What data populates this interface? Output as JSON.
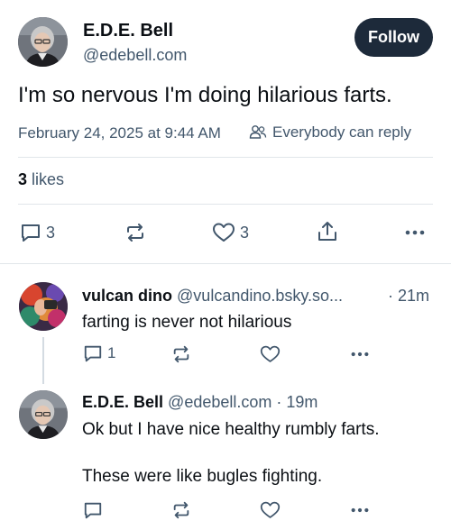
{
  "main_post": {
    "author": {
      "display_name": "E.D.E. Bell",
      "handle": "@edebell.com",
      "avatar_icon": "avatar-gray-hair-glasses"
    },
    "follow_label": "Follow",
    "text": "I'm so nervous I'm doing hilarious farts.",
    "timestamp": "February 24, 2025 at 9:44 AM",
    "reply_setting": "Everybody can reply",
    "likes_count": "3",
    "likes_label": "likes",
    "actions": {
      "reply_count": "3",
      "like_count": "3"
    }
  },
  "replies": [
    {
      "display_name": "vulcan dino",
      "handle": "@vulcandino.bsky.so...",
      "time": "· 21m",
      "text": "farting is never not hilarious",
      "reply_count": "1",
      "avatar_icon": "avatar-colorful"
    },
    {
      "display_name": "E.D.E. Bell",
      "handle": "@edebell.com",
      "time": "· 19m",
      "text_line1": "Ok but I have nice healthy rumbly farts.",
      "text_line2": "These were like bugles fighting.",
      "avatar_icon": "avatar-gray-hair-glasses"
    }
  ],
  "colors": {
    "text": "#0b0f14",
    "muted": "#42576c",
    "follow_bg": "#1d2a3a",
    "divider": "#e1e6ea"
  }
}
